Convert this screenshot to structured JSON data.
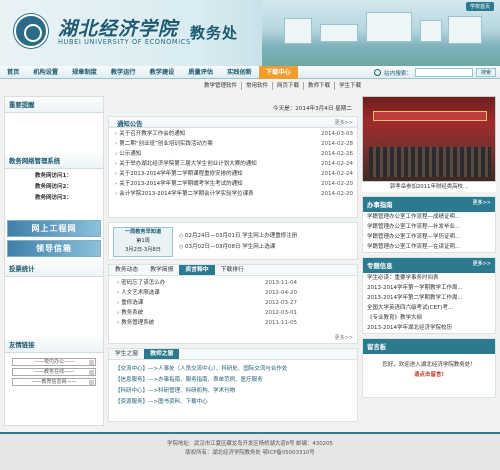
{
  "header": {
    "logo_cn": "湖北经济学院",
    "logo_en": "HUBEI UNIVERSITY OF ECONOMICS",
    "site_name": "教务处",
    "home_link": "学校首页"
  },
  "nav": {
    "items": [
      "首页",
      "机构设置",
      "规章制度",
      "教学运行",
      "教学建设",
      "质量评估",
      "实践创新",
      "下载中心"
    ],
    "active_index": 7,
    "search_label": "站内搜索：",
    "search_button": "搜索"
  },
  "quick_links": [
    "教学管理软件",
    "常用软件",
    "网页下载",
    "教师下载",
    "学生下载"
  ],
  "left": {
    "notice_title": "重要提醒",
    "net_title": "教务网络管理系统",
    "net_items": [
      "教务网访问1：",
      "教务网访问2：",
      "教务网访问3："
    ],
    "banner1": "网上工程网",
    "banner2": "领导信箱",
    "vote_title": "投票统计",
    "links_title": "友情链接",
    "selects": [
      "——校内办公——",
      "——教务在线——",
      "——教育信息网——"
    ]
  },
  "main": {
    "date": "今天是：2014年3月4日 星期二",
    "notices": {
      "title": "通知公告",
      "more": "更多>>",
      "rows": [
        {
          "text": "关于召开教学工作会的通知",
          "date": "2014-03-03"
        },
        {
          "text": "第二期“创业班”创业培训实践活动方案",
          "date": "2014-02-28"
        },
        {
          "text": "公示通知",
          "date": "2014-02-26"
        },
        {
          "text": "关于举办湖北经济学院第三届大学生创业计划大赛的通知",
          "date": "2014-02-24"
        },
        {
          "text": "关于2013-2014学年第二学期课程重修安排的通知",
          "date": "2014-02-24"
        },
        {
          "text": "关于2013-2014学年第二学期缓考学生考试的通知",
          "date": "2014-02-20"
        },
        {
          "text": "会计学院2013-2014学年第二学期会计学实验学位课表",
          "date": "2014-02-20"
        }
      ]
    },
    "calendar": {
      "line1": "一周教务早知道",
      "line2": "第1周",
      "line3": "3月2日-3月8日"
    },
    "calendar_items": [
      "◇ 02月24日—03月01日 学生网上办理重修注册",
      "◇ 03月02日—03月08日 学生网上选课"
    ],
    "tabs1": [
      "教务动态",
      "教学简报",
      "资言释中",
      "下载排行"
    ],
    "tabs1_active": 2,
    "tab_rows": [
      {
        "text": "密码忘了该怎么办",
        "date": "2013-11-04"
      },
      {
        "text": "人文艺术限选课",
        "date": "2012-04-20"
      },
      {
        "text": "重修选课",
        "date": "2012-03-27"
      },
      {
        "text": "教务系统",
        "date": "2012-03-01"
      },
      {
        "text": "教务管理系统",
        "date": "2011-11-05"
      }
    ],
    "more": "更多>>",
    "tabs2": [
      "学生之窗",
      "教师之窗"
    ],
    "tabs2_active": 1,
    "service_rows": [
      "【交流中心】—>人事处（人员交流中心）、科研处、国际交流与合作处",
      "【信息服务】—>办事指南、服务指南、表单范例、医疗服务",
      "【科研中心】—>科研管理、科研机构、学术刊物",
      "【资源服务】—>图书资料、下载中心"
    ]
  },
  "right": {
    "photo_caption": "郭孝岳参加2011年财经类高校...",
    "guide": {
      "title": "办事指南",
      "more": "更多>>",
      "rows": [
        "学籍管理办公室工作流程—成绩证明...",
        "学籍管理办公室工作流程—补发毕业...",
        "学籍管理办公室工作流程—学历证明...",
        "学籍管理办公室工作流程—在读证明..."
      ]
    },
    "topics": {
      "title": "专题信息",
      "more": "更多>>",
      "rows": [
        "学生必读：重要学事务时间表",
        "2013-2014学年第一学期教学工作周...",
        "2013-2014学年第二学期教学工作周...",
        "全国大学英语四六级考试(CET)考...",
        "《专业教育》教学大纲",
        "2013-2014学年湖北经济学院校历"
      ]
    },
    "guestbook": {
      "title": "留言板",
      "text": "您好，欢迎进入湖北经济学院教务处！",
      "link": "请点击留言!"
    }
  },
  "footer": {
    "line1": "学院地址：武汉市江夏区藏龙岛开发区杨桥湖大道8号    邮编：430205",
    "line2": "版权所有：湖北经济学院教务处        鄂ICP备05003310号"
  }
}
